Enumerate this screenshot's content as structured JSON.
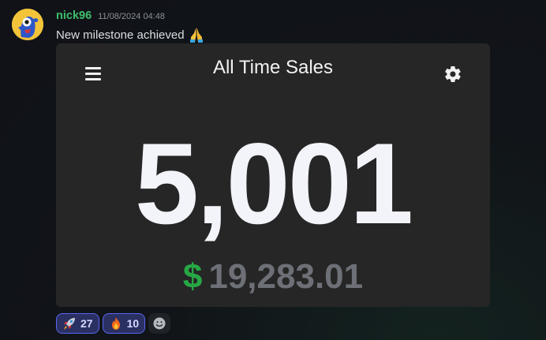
{
  "message": {
    "username": "nick96",
    "timestamp": "11/08/2024 04:48",
    "text": "New milestone achieved",
    "text_emoji": "pray-icon"
  },
  "embed": {
    "title": "All Time Sales",
    "sales_count": "5,001",
    "currency_symbol": "$",
    "revenue": "19,283.01"
  },
  "reactions": [
    {
      "emoji": "rocket-icon",
      "count": "27"
    },
    {
      "emoji": "fire-icon",
      "count": "10"
    }
  ],
  "colors": {
    "username": "#3fbf6a",
    "currency": "#27a845",
    "embed_bg": "#262626",
    "reaction_border": "#5865f2"
  }
}
